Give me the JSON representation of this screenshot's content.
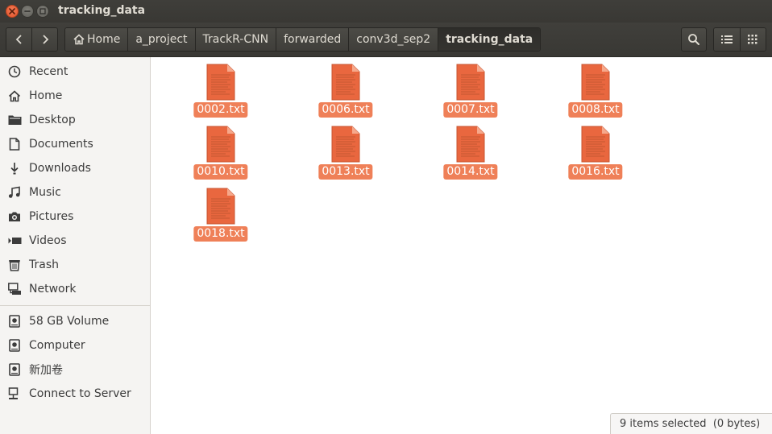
{
  "window": {
    "title": "tracking_data"
  },
  "breadcrumbs": [
    {
      "label": "Home"
    },
    {
      "label": "a_project"
    },
    {
      "label": "TrackR-CNN"
    },
    {
      "label": "forwarded"
    },
    {
      "label": "conv3d_sep2"
    },
    {
      "label": "tracking_data"
    }
  ],
  "sidebar": {
    "places": [
      {
        "label": "Recent",
        "icon": "clock-icon"
      },
      {
        "label": "Home",
        "icon": "home-icon"
      },
      {
        "label": "Desktop",
        "icon": "folder-icon"
      },
      {
        "label": "Documents",
        "icon": "document-icon"
      },
      {
        "label": "Downloads",
        "icon": "download-icon"
      },
      {
        "label": "Music",
        "icon": "music-icon"
      },
      {
        "label": "Pictures",
        "icon": "camera-icon"
      },
      {
        "label": "Videos",
        "icon": "video-icon"
      },
      {
        "label": "Trash",
        "icon": "trash-icon"
      },
      {
        "label": "Network",
        "icon": "network-icon"
      }
    ],
    "devices": [
      {
        "label": "58 GB Volume",
        "icon": "drive-icon"
      },
      {
        "label": "Computer",
        "icon": "drive-icon"
      },
      {
        "label": "新加卷",
        "icon": "drive-icon"
      },
      {
        "label": "Connect to Server",
        "icon": "server-icon"
      }
    ]
  },
  "files": [
    {
      "name": "0002.txt",
      "selected": true
    },
    {
      "name": "0006.txt",
      "selected": true
    },
    {
      "name": "0007.txt",
      "selected": true
    },
    {
      "name": "0008.txt",
      "selected": true
    },
    {
      "name": "0010.txt",
      "selected": true
    },
    {
      "name": "0013.txt",
      "selected": true
    },
    {
      "name": "0014.txt",
      "selected": true
    },
    {
      "name": "0016.txt",
      "selected": true
    },
    {
      "name": "0018.txt",
      "selected": true
    }
  ],
  "status": {
    "text": "9 items selected  (0 bytes)"
  },
  "colors": {
    "accent": "#ef8058",
    "titlebar": "#3c3b37",
    "file_icon": "#e9673f"
  }
}
